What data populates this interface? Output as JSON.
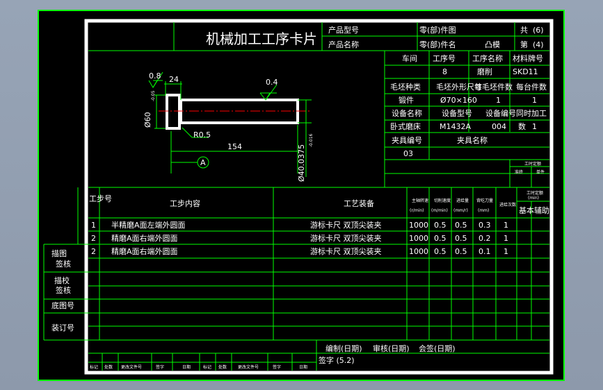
{
  "colors": {
    "viewport_bg": "#97a4b6",
    "frame_bg": "#000000",
    "outer_frame": "#00ff00",
    "grid_line": "#00ff00",
    "text": "#ffffff",
    "part_outline": "#ffffff",
    "center_line": "#ff0000",
    "dimension": "#00ff00"
  },
  "header": {
    "title": "机械加工工序卡片",
    "product_model_label": "产品型号",
    "product_name_label": "产品名称",
    "part_no_label": "零(部)件图",
    "part_name_label": "零(部)件名",
    "part_name_value": "凸模",
    "total_label": "共",
    "total_value": "(6)",
    "page_label": "第",
    "page_value": "(4)"
  },
  "info": {
    "workshop_label": "车间",
    "op_no_label": "工序号",
    "op_name_label": "工序名称",
    "material_label": "材料牌号",
    "op_no_value": "8",
    "op_name_value": "磨削",
    "material_value": "SKD11",
    "blank_type_label": "毛坯种类",
    "blank_size_label": "毛坯外形尺寸",
    "blank_count_label": "每毛坯件数",
    "per_set_label": "每台件数",
    "blank_type_value": "锻件",
    "blank_size_value": "Ø70×160",
    "blank_count_value": "1",
    "per_set_value": "1",
    "equip_name_label": "设备名称",
    "equip_model_label": "设备型号",
    "equip_no_label": "设备编号",
    "simul_label": "同时加工",
    "equip_name_value": "卧式磨床",
    "equip_model_value": "M1432A",
    "equip_no_value": "004",
    "simul_count_label": "数",
    "simul_value": "1",
    "fixture_no_label": "夹具编号",
    "fixture_name_label": "夹具名称",
    "fixture_no_value": "03",
    "hours_label": "工时定额",
    "hours_sub1": "准终",
    "hours_sub2": "单件"
  },
  "drawing": {
    "roughness_left": "0.8",
    "roughness_right": "0.4",
    "dim_head_len": "24",
    "dim_head_dia": "Ø60",
    "dim_head_tol": "-0.05",
    "dim_radius": "R0.5",
    "dim_length": "154",
    "dim_shaft_dia": "Ø40.0375",
    "dim_shaft_tol": "-0.016",
    "datum": "A"
  },
  "steps_table": {
    "headers": {
      "step_no": "工步号",
      "content": "工步内容",
      "equipment": "工艺装备",
      "spindle": "主轴转速",
      "spindle_unit": "(r/min)",
      "cut_speed": "切削速度",
      "cut_speed_unit": "(m/min)",
      "feed": "进给量",
      "feed_unit": "(mm/r)",
      "depth": "背吃刀量",
      "depth_unit": "(mm)",
      "passes": "进给次数",
      "time_header": "工时定额",
      "time_unit": "(min)",
      "basic": "基本",
      "aux": "辅助"
    },
    "rows": [
      {
        "no": "1",
        "content": "半精磨A面左端外圆面",
        "equipment": "游标卡尺  双顶尖装夹",
        "spindle": "1000",
        "speed": "0.5",
        "feed": "0.5",
        "depth": "0.3",
        "passes": "1"
      },
      {
        "no": "2",
        "content": "精磨A面右端外圆面",
        "equipment": "游标卡尺  双顶尖装夹",
        "spindle": "1000",
        "speed": "0.5",
        "feed": "0.5",
        "depth": "0.2",
        "passes": "1"
      },
      {
        "no": "2",
        "content": "精磨A面右端外圆面",
        "equipment": "游标卡尺  双顶尖装夹",
        "spindle": "1000",
        "speed": "0.5",
        "feed": "0.5",
        "depth": "0.1",
        "passes": "1"
      }
    ]
  },
  "side_labels": {
    "trace": "描图",
    "trace_check": "描校",
    "base_no": "底图号",
    "binding_no": "装订号",
    "check1": "签核",
    "check2": "签核"
  },
  "footer": {
    "compile": "编制(日期)",
    "review": "审核(日期)",
    "countersign": "会签(日期)",
    "signature": "签字 (5.2)",
    "bottom_row": [
      "标记",
      "处数",
      "更改文件号",
      "签字",
      "日期",
      "标记",
      "处数",
      "更改文件号",
      "签字",
      "日期"
    ]
  }
}
